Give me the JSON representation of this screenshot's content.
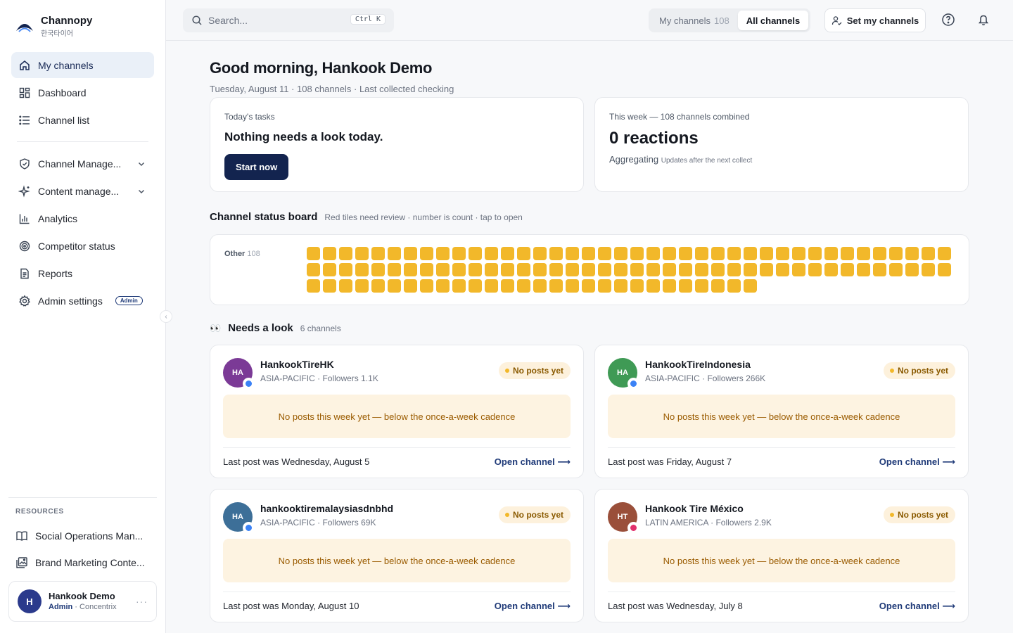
{
  "brand": {
    "name": "Channopy",
    "sub": "한국타이어"
  },
  "nav": {
    "items": [
      {
        "label": "My channels",
        "icon": "home-icon"
      },
      {
        "label": "Dashboard",
        "icon": "grid-icon"
      },
      {
        "label": "Channel list",
        "icon": "list-icon"
      },
      {
        "label": "Channel Manage...",
        "icon": "shield-icon"
      },
      {
        "label": "Content manage...",
        "icon": "sparkle-icon"
      },
      {
        "label": "Analytics",
        "icon": "bar-chart-icon"
      },
      {
        "label": "Competitor status",
        "icon": "target-icon"
      },
      {
        "label": "Reports",
        "icon": "document-icon"
      },
      {
        "label": "Admin settings",
        "icon": "gear-icon",
        "badge": "Admin"
      }
    ]
  },
  "resources": {
    "title": "RESOURCES",
    "items": [
      {
        "label": "Social Operations Man..."
      },
      {
        "label": "Brand Marketing Conte..."
      }
    ]
  },
  "user": {
    "initial": "H",
    "name": "Hankook Demo",
    "role": "Admin",
    "org": " · Concentrix"
  },
  "topbar": {
    "search_placeholder": "Search...",
    "shortcut": "Ctrl K",
    "seg_my": "My channels",
    "seg_my_count": "108",
    "seg_all": "All channels",
    "set_label": "Set my channels"
  },
  "main": {
    "greeting": "Good morning, Hankook Demo",
    "subline": "Tuesday, August 11 · 108 channels · Last collected checking"
  },
  "tasks": {
    "kicker": "Today's tasks",
    "title": "Nothing needs a look today.",
    "button": "Start now"
  },
  "week": {
    "kicker": "This week — 108 channels combined",
    "value": "0 reactions",
    "agg": "Aggregating",
    "agg_note": "Updates after the next collect"
  },
  "board": {
    "title": "Channel status board",
    "hint": "Red tiles need review · number is count · tap to open",
    "group_label": "Other",
    "group_count": "108",
    "tile_count": 108,
    "tile_color": "#f2b82a"
  },
  "needs": {
    "title": "Needs a look",
    "count": "6 channels",
    "cards": [
      {
        "initials": "HA",
        "avatar_color": "#7b3a96",
        "platform_color": "#3b82f6",
        "name": "HankookTireHK",
        "region": "ASIA-PACIFIC · Followers 1.1K",
        "status": "No posts yet",
        "warning": "No posts this week yet — below the once-a-week cadence",
        "last_post": "Last post was Wednesday, August 5",
        "link": "Open channel ⟶"
      },
      {
        "initials": "HA",
        "avatar_color": "#3f9a55",
        "platform_color": "#3b82f6",
        "name": "HankookTireIndonesia",
        "region": "ASIA-PACIFIC · Followers 266K",
        "status": "No posts yet",
        "warning": "No posts this week yet — below the once-a-week cadence",
        "last_post": "Last post was Friday, August 7",
        "link": "Open channel ⟶"
      },
      {
        "initials": "HA",
        "avatar_color": "#3d6f98",
        "platform_color": "#3b82f6",
        "name": "hankooktiremalaysiasdnbhd",
        "region": "ASIA-PACIFIC · Followers 69K",
        "status": "No posts yet",
        "warning": "No posts this week yet — below the once-a-week cadence",
        "last_post": "Last post was Monday, August 10",
        "link": "Open channel ⟶"
      },
      {
        "initials": "HT",
        "avatar_color": "#9a4f3a",
        "platform_color": "#e1306c",
        "name": "Hankook Tire México",
        "region": "LATIN AMERICA · Followers 2.9K",
        "status": "No posts yet",
        "warning": "No posts this week yet — below the once-a-week cadence",
        "last_post": "Last post was Wednesday, July 8",
        "link": "Open channel ⟶"
      }
    ]
  },
  "colors": {
    "accent": "#13244f",
    "tile": "#f2b82a",
    "warn_bg": "#fdf3e1"
  }
}
